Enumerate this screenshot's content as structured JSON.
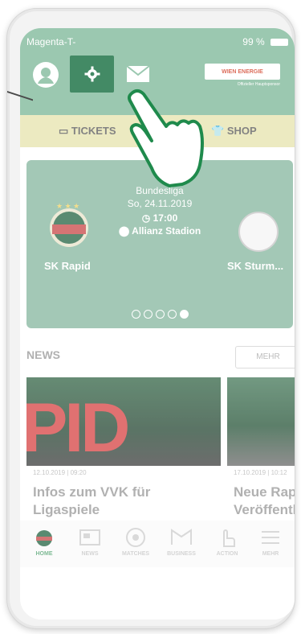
{
  "status_bar": {
    "carrier": "Magenta-T-",
    "battery": "99 %"
  },
  "header": {
    "sponsor_name": "WIEN ENERGIE",
    "sponsor_subtitle": "Offizieller Hauptsponsor"
  },
  "tabs": [
    {
      "label": "TICKETS",
      "icon": "ticket-icon"
    },
    {
      "label": "SHOP",
      "icon": "shirt-icon"
    }
  ],
  "match": {
    "league": "Bundesliga",
    "date": "So, 24.11.2019",
    "time": "17:00",
    "venue": "Allianz Stadion",
    "home_team": "SK Rapid",
    "away_team": "SK Sturm...",
    "carousel_total": 5,
    "carousel_active": 5
  },
  "news": {
    "heading": "NEWS",
    "more_label": "MEHR",
    "items": [
      {
        "date": "12.10.2019 | 09:20",
        "title_line1": "Infos zum VVK für",
        "title_line2": "Ligaspiele",
        "image_text": "PID"
      },
      {
        "date": "17.10.2019 | 10:12",
        "title_line1": "Neue Rap",
        "title_line2": "Veröffentli"
      }
    ]
  },
  "bottom_nav": [
    {
      "label": "HOME",
      "icon": "crest-icon",
      "active": true
    },
    {
      "label": "NEWS",
      "icon": "newspaper-icon",
      "active": false
    },
    {
      "label": "MATCHES",
      "icon": "football-icon",
      "active": false
    },
    {
      "label": "BUSINESS",
      "icon": "business-icon",
      "active": false
    },
    {
      "label": "ACTION",
      "icon": "hand-icon",
      "active": false
    },
    {
      "label": "MEHR",
      "icon": "menu-icon",
      "active": false
    }
  ],
  "colors": {
    "header_green": "#7fb99a",
    "settings_green": "#0f6a3a",
    "tab_yellow": "#e7e4b0",
    "card_green": "#8ab9a2",
    "active_nav": "#5aa777",
    "hand_green": "#1f8a4c"
  }
}
